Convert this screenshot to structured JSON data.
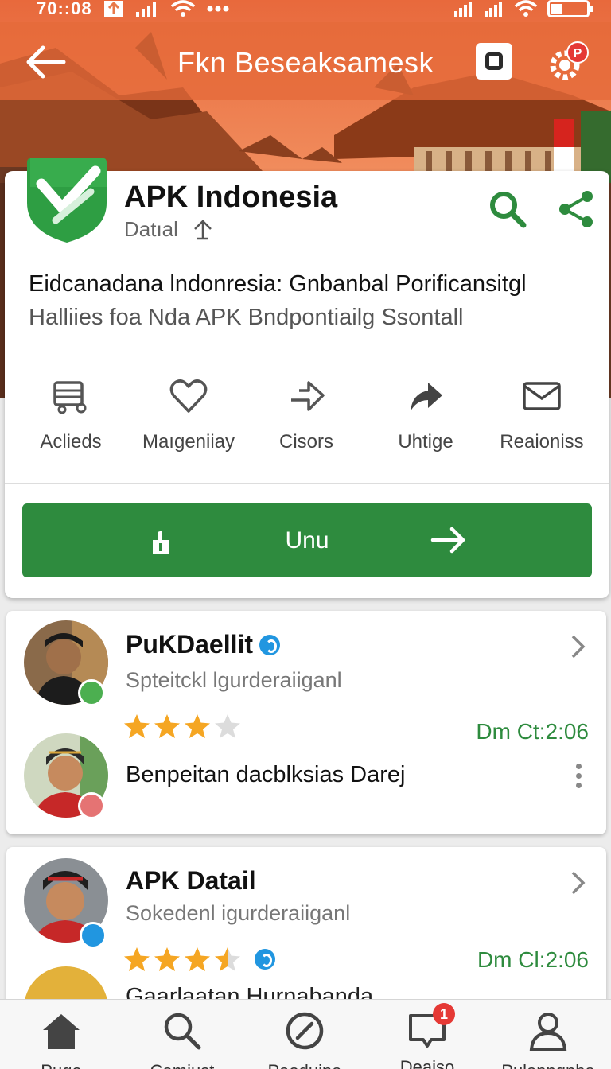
{
  "status_bar": {
    "time": "70::08"
  },
  "app_bar": {
    "title": "Fkn Beseaksamesk",
    "notification_badge": "P"
  },
  "app": {
    "name": "APK Indonesia",
    "subtitle": "Datıal",
    "description_line1": "Eidcanadana lndonresia: Gnbanbal Porificansitgl",
    "description_line2": "Halliies foa Nda APK Bndpontiailg Ssontall",
    "logo_color": "#2e9e43"
  },
  "actions": [
    {
      "label": "Aclieds",
      "icon": "cart-icon"
    },
    {
      "label": "Maıgeniiay",
      "icon": "heart-icon"
    },
    {
      "label": "Cisors",
      "icon": "forward-arrow-icon"
    },
    {
      "label": "Uhtige",
      "icon": "share-arrow-icon"
    },
    {
      "label": "Reaioniss",
      "icon": "mail-icon"
    }
  ],
  "primary_button": {
    "label": "Unu"
  },
  "reviews": [
    {
      "name": "PuKDaellit",
      "subtitle": "Spteitckl lgurderaiiganl",
      "rating": 3,
      "time": "Dm Ct:2:06",
      "text": "Benpeitan dacblksias Darej"
    },
    {
      "name": "APK Datail",
      "subtitle": "Sokedenl igurderaiiganl",
      "rating": 3.5,
      "time": "Dm Cl:2:06",
      "text": "Gaarlaatan Hurnabanda"
    }
  ],
  "bottom_nav": [
    {
      "label": "Pugo",
      "icon": "home-icon"
    },
    {
      "label": "Camiust",
      "icon": "search-icon"
    },
    {
      "label": "Paoduina",
      "icon": "compass-icon"
    },
    {
      "label": "Deaiso",
      "icon": "chat-icon",
      "badge": "1"
    },
    {
      "label": "Pulanngnha",
      "icon": "profile-icon"
    }
  ],
  "colors": {
    "accent_green": "#2e8b3e",
    "header_orange": "#e8794a",
    "star": "#f5a623",
    "verified_blue": "#2196e0"
  }
}
